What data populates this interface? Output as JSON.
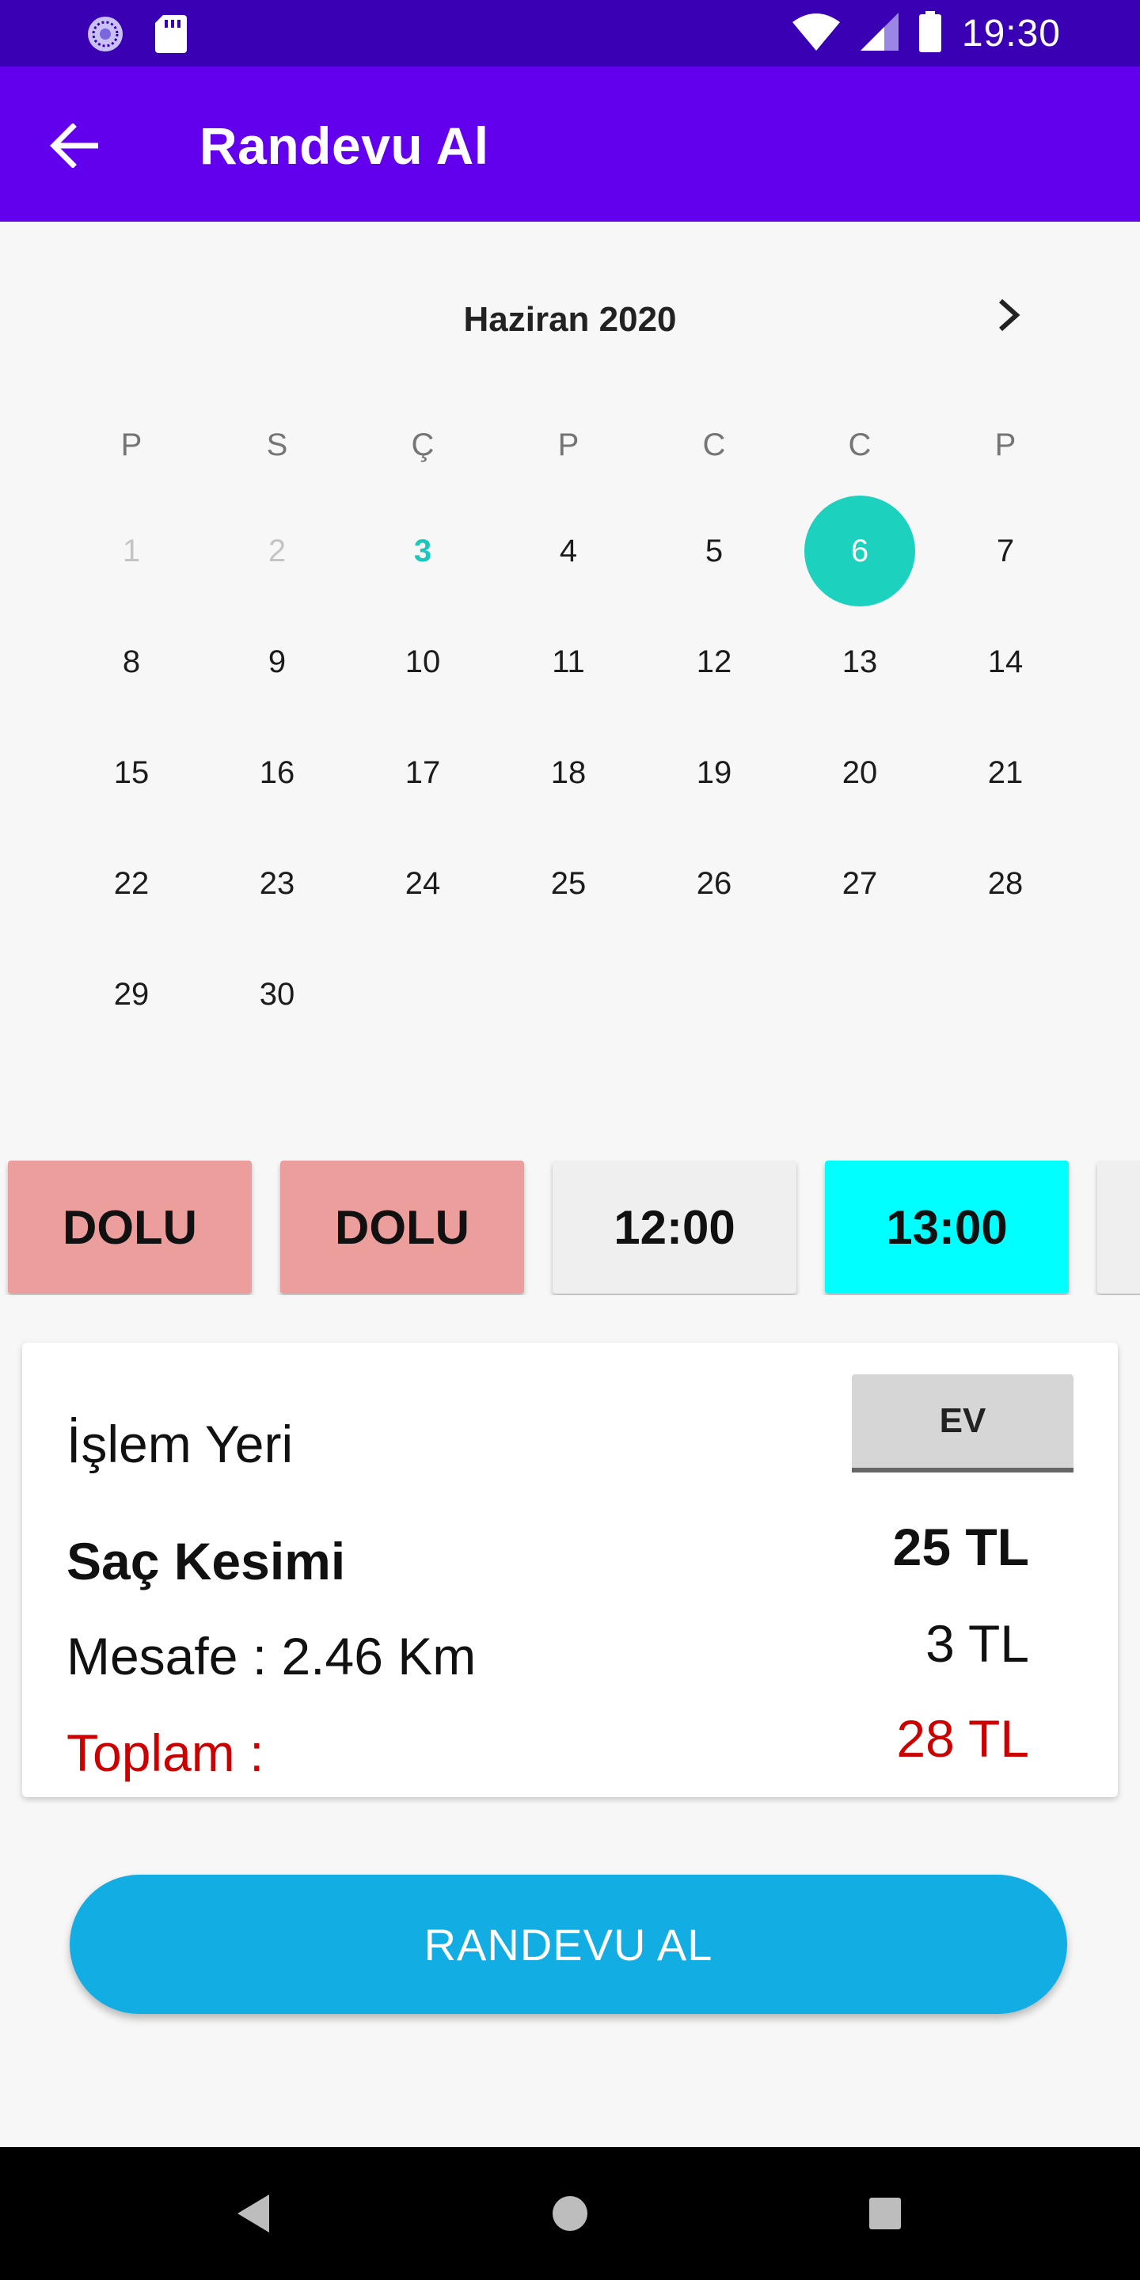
{
  "status_bar": {
    "time": "19:30",
    "left_icons": [
      "sync-icon",
      "sd-card-icon"
    ],
    "right_icons": [
      "wifi-icon",
      "signal-icon",
      "battery-icon"
    ]
  },
  "app_bar": {
    "title": "Randevu Al",
    "back_icon": "arrow-left-icon"
  },
  "calendar": {
    "month_title": "Haziran 2020",
    "next_icon": "chevron-right-icon",
    "weekdays": [
      "P",
      "S",
      "Ç",
      "P",
      "C",
      "C",
      "P"
    ],
    "weeks": [
      [
        "1",
        "2",
        "3",
        "4",
        "5",
        "6",
        "7"
      ],
      [
        "8",
        "9",
        "10",
        "11",
        "12",
        "13",
        "14"
      ],
      [
        "15",
        "16",
        "17",
        "18",
        "19",
        "20",
        "21"
      ],
      [
        "22",
        "23",
        "24",
        "25",
        "26",
        "27",
        "28"
      ],
      [
        "29",
        "30"
      ]
    ],
    "today": "3",
    "selected": "6",
    "past_days": [
      "1",
      "2"
    ]
  },
  "slots": [
    {
      "label": "DOLU",
      "state": "full"
    },
    {
      "label": "DOLU",
      "state": "full"
    },
    {
      "label": "12:00",
      "state": "free"
    },
    {
      "label": "13:00",
      "state": "chosen"
    }
  ],
  "details": {
    "place_label": "İşlem Yeri",
    "place_value": "EV",
    "service_name": "Saç Kesimi",
    "service_price": "25 TL",
    "distance_label": "Mesafe : 2.46 Km",
    "distance_price": "3 TL",
    "total_label": "Toplam :",
    "total_price": "28 TL"
  },
  "book_button": "RANDEVU AL",
  "colors": {
    "status_bar": "#3a00b4",
    "app_bar": "#6200ee",
    "selected_day": "#1dd1bf",
    "slot_full": "#ec9e9d",
    "slot_chosen": "#00ffff",
    "total": "#cc0000",
    "book_button": "#12ade3"
  },
  "nav_bar": [
    "back-triangle-icon",
    "home-circle-icon",
    "recents-square-icon"
  ]
}
